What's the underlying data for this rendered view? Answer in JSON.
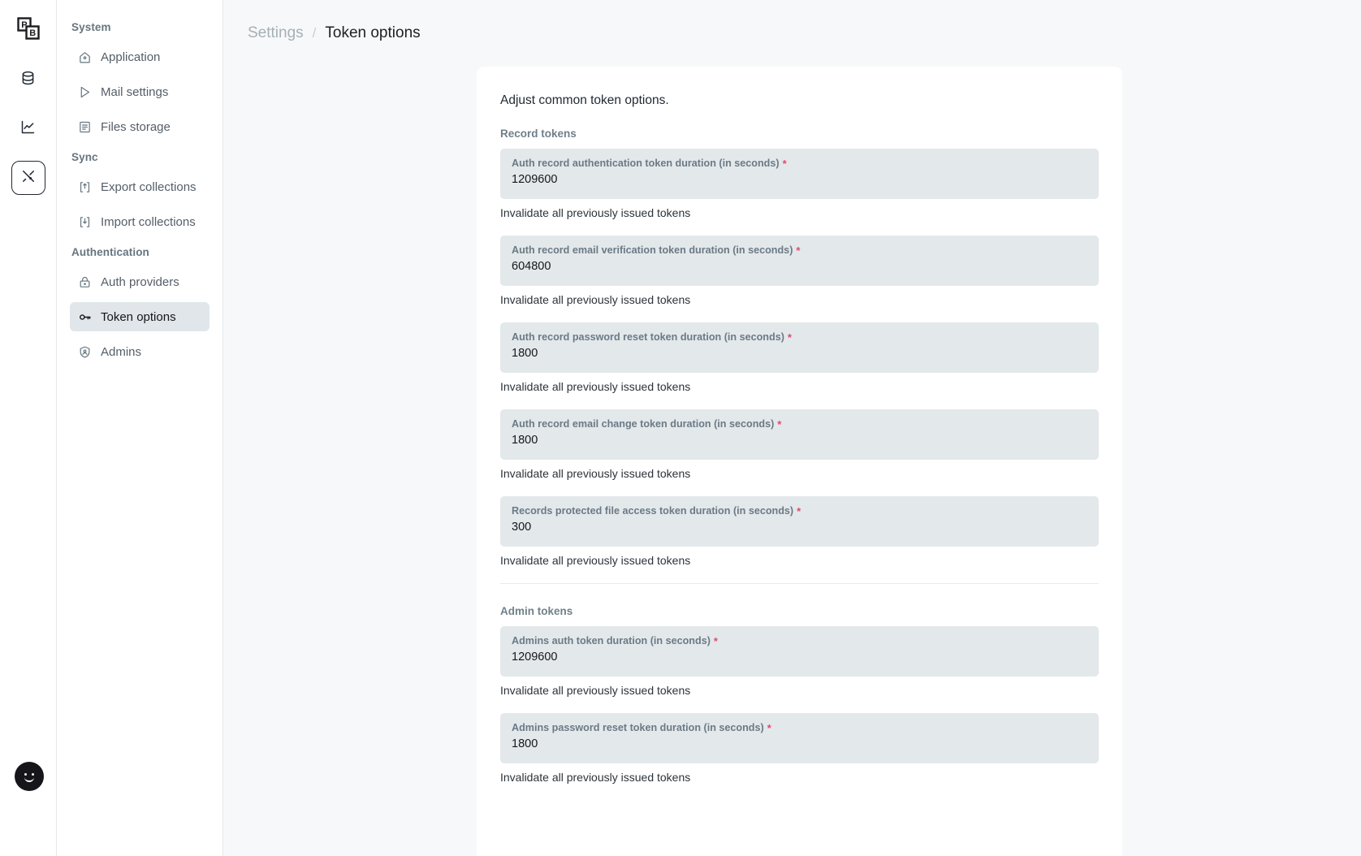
{
  "rail": {
    "logo": "pocketbase-logo",
    "items": [
      {
        "icon": "database-icon",
        "name": "collections",
        "active": false
      },
      {
        "icon": "chart-line-icon",
        "name": "logs",
        "active": false
      },
      {
        "icon": "tools-icon",
        "name": "settings",
        "active": true
      }
    ],
    "avatar": "user-avatar-smiley"
  },
  "sidebar": {
    "groups": [
      {
        "title": "System",
        "items": [
          {
            "label": "Application",
            "icon": "home-icon",
            "active": false
          },
          {
            "label": "Mail settings",
            "icon": "send-icon",
            "active": false
          },
          {
            "label": "Files storage",
            "icon": "archive-icon",
            "active": false
          }
        ]
      },
      {
        "title": "Sync",
        "items": [
          {
            "label": "Export collections",
            "icon": "export-icon",
            "active": false
          },
          {
            "label": "Import collections",
            "icon": "import-icon",
            "active": false
          }
        ]
      },
      {
        "title": "Authentication",
        "items": [
          {
            "label": "Auth providers",
            "icon": "lock-icon",
            "active": false
          },
          {
            "label": "Token options",
            "icon": "key-icon",
            "active": true
          },
          {
            "label": "Admins",
            "icon": "shield-user-icon",
            "active": false
          }
        ]
      }
    ]
  },
  "breadcrumb": {
    "parent": "Settings",
    "separator": "/",
    "current": "Token options"
  },
  "page": {
    "intro": "Adjust common token options.",
    "sections": [
      {
        "title": "Record tokens",
        "fields": [
          {
            "label": "Auth record authentication token duration (in seconds)",
            "required": "*",
            "value": "1209600",
            "helper": "Invalidate all previously issued tokens"
          },
          {
            "label": "Auth record email verification token duration (in seconds)",
            "required": "*",
            "value": "604800",
            "helper": "Invalidate all previously issued tokens"
          },
          {
            "label": "Auth record password reset token duration (in seconds)",
            "required": "*",
            "value": "1800",
            "helper": "Invalidate all previously issued tokens"
          },
          {
            "label": "Auth record email change token duration (in seconds)",
            "required": "*",
            "value": "1800",
            "helper": "Invalidate all previously issued tokens"
          },
          {
            "label": "Records protected file access token duration (in seconds)",
            "required": "*",
            "value": "300",
            "helper": "Invalidate all previously issued tokens"
          }
        ]
      },
      {
        "title": "Admin tokens",
        "fields": [
          {
            "label": "Admins auth token duration (in seconds)",
            "required": "*",
            "value": "1209600",
            "helper": "Invalidate all previously issued tokens"
          },
          {
            "label": "Admins password reset token duration (in seconds)",
            "required": "*",
            "value": "1800",
            "helper": "Invalidate all previously issued tokens"
          }
        ]
      }
    ]
  },
  "colors": {
    "page_bg": "#f7f8f9",
    "card_bg": "#ffffff",
    "field_bg": "#e3e8eb",
    "active_nav_bg": "#e1e6ea",
    "required_asterisk": "#e34a6f",
    "muted_text": "#70808a"
  }
}
